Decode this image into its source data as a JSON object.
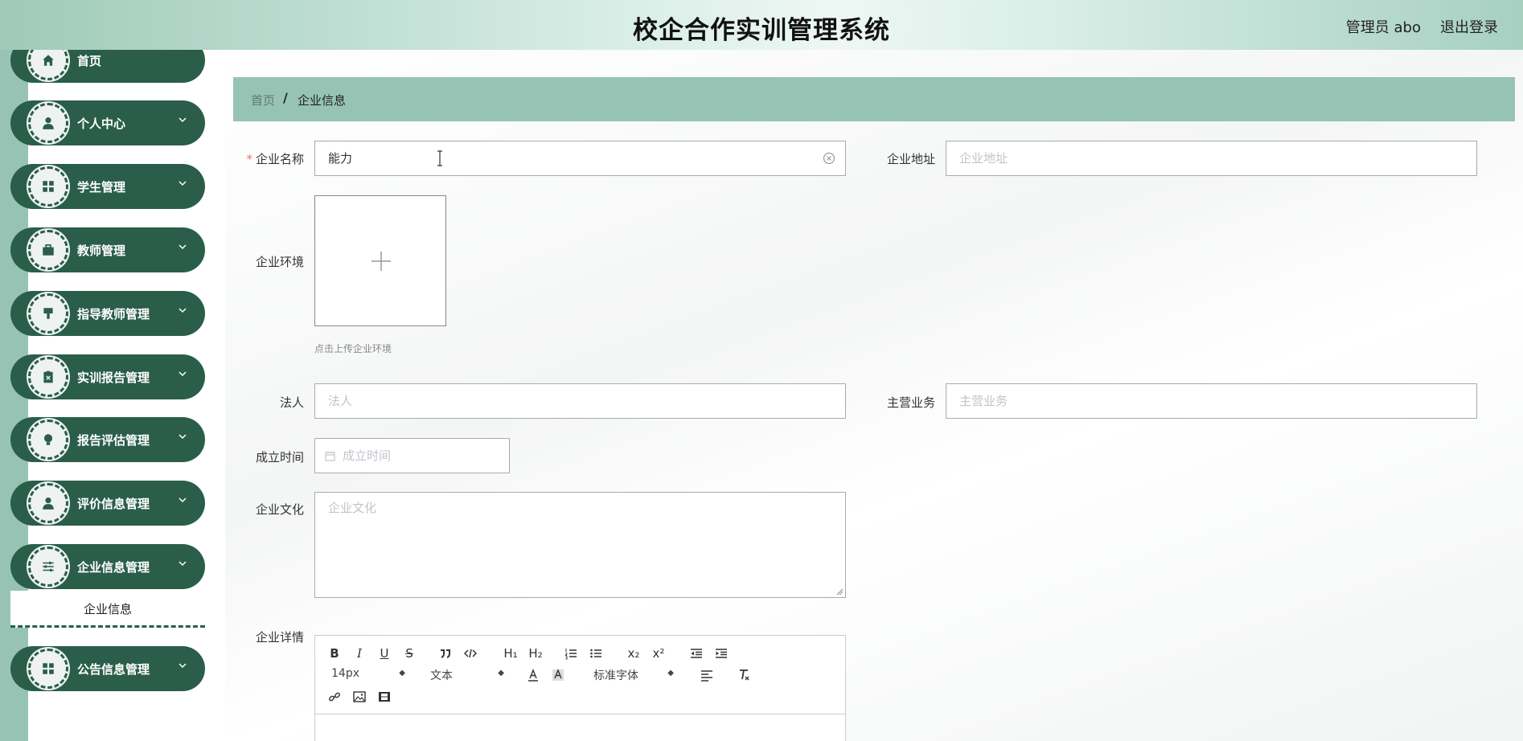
{
  "header": {
    "title": "校企合作实训管理系统",
    "user": "管理员 abo",
    "logout": "退出登录"
  },
  "sidebar": {
    "items": [
      {
        "label": "首页",
        "icon": "home-icon"
      },
      {
        "label": "个人中心",
        "icon": "user-icon"
      },
      {
        "label": "学生管理",
        "icon": "grid-icon"
      },
      {
        "label": "教师管理",
        "icon": "briefcase-icon"
      },
      {
        "label": "指导教师管理",
        "icon": "brush-icon"
      },
      {
        "label": "实训报告管理",
        "icon": "clipboard-icon"
      },
      {
        "label": "报告评估管理",
        "icon": "bulb-icon"
      },
      {
        "label": "评价信息管理",
        "icon": "user-icon"
      },
      {
        "label": "企业信息管理",
        "icon": "sliders-icon"
      },
      {
        "label": "公告信息管理",
        "icon": "grid-icon"
      }
    ],
    "submenu": "企业信息"
  },
  "breadcrumb": {
    "home": "首页",
    "sep": "/",
    "current": "企业信息"
  },
  "form": {
    "name_label": "企业名称",
    "name_required": "*",
    "name_value": "能力",
    "address_label": "企业地址",
    "address_placeholder": "企业地址",
    "env_label": "企业环境",
    "env_tip": "点击上传企业环境",
    "legal_label": "法人",
    "legal_placeholder": "法人",
    "business_label": "主营业务",
    "business_placeholder": "主营业务",
    "founded_label": "成立时间",
    "founded_placeholder": "成立时间",
    "culture_label": "企业文化",
    "culture_placeholder": "企业文化",
    "detail_label": "企业详情"
  },
  "editor": {
    "font_size": "14px",
    "header_type": "文本",
    "font_family": "标准字体",
    "buttons": [
      "B",
      "I",
      "U",
      "S"
    ],
    "sub": "x₂",
    "sup": "x²",
    "h1": "H₁",
    "h2": "H₂"
  }
}
